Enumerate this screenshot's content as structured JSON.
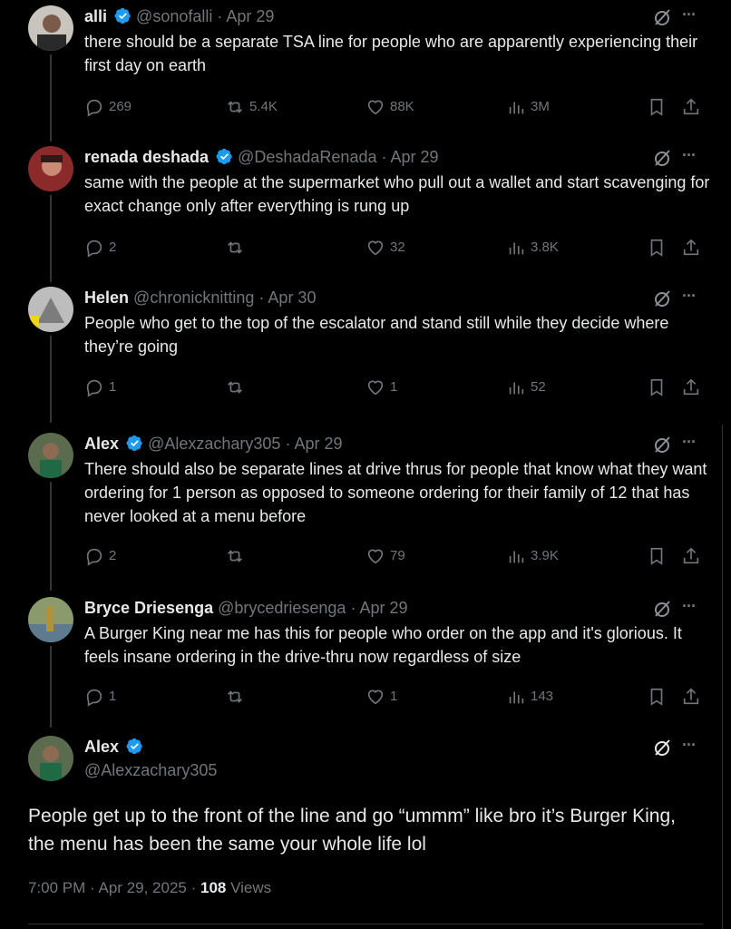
{
  "colors": {
    "background": "#000000",
    "text": "#e7e9ea",
    "muted": "#71767b",
    "verified": "#1d9bf0"
  },
  "replies": [
    {
      "name": "alli",
      "verified": true,
      "handle": "@sonofalli",
      "date": "Apr 29",
      "text": "there should be a separate TSA line for people who are apparently experiencing their first day on earth",
      "replies": "269",
      "reposts": "5.4K",
      "likes": "88K",
      "views": "3M"
    },
    {
      "name": "renada deshada",
      "verified": true,
      "handle": "@DeshadaRenada",
      "date": "Apr 29",
      "text": "same with the people at the supermarket who  pull out a wallet and start scavenging for exact change only after everything is rung up",
      "replies": "2",
      "reposts": "",
      "likes": "32",
      "views": "3.8K"
    },
    {
      "name": "Helen",
      "verified": false,
      "handle": "@chronicknitting",
      "date": "Apr 30",
      "text": "People who get to the top of the escalator and stand still while they decide where they’re going",
      "replies": "1",
      "reposts": "",
      "likes": "1",
      "views": "52"
    },
    {
      "name": "Alex",
      "verified": true,
      "handle": "@Alexzachary305",
      "date": "Apr 29",
      "text": "There should also be separate lines at drive thrus for people that know what they want ordering for 1 person as opposed to someone ordering for their family of 12 that has never looked at a menu before",
      "replies": "2",
      "reposts": "",
      "likes": "79",
      "views": "3.9K"
    },
    {
      "name": "Bryce Driesenga",
      "verified": false,
      "handle": "@brycedriesenga",
      "date": "Apr 29",
      "text": "A Burger King near me has this for people who order on the app and it's glorious. It feels insane ordering in the drive-thru now regardless of size",
      "replies": "1",
      "reposts": "",
      "likes": "1",
      "views": "143"
    }
  ],
  "main": {
    "name": "Alex",
    "verified": true,
    "handle": "@Alexzachary305",
    "text": "People get up to the front of the line and go “ummm” like bro it’s Burger King, the menu has been the same your whole life lol",
    "time": "7:00 PM",
    "date": "Apr 29, 2025",
    "views_count": "108",
    "views_label": "Views"
  },
  "icons": {
    "reply": "reply-icon",
    "repost": "repost-icon",
    "like": "heart-icon",
    "views": "analytics-icon",
    "bookmark": "bookmark-icon",
    "share": "share-icon",
    "grok": "grok-icon",
    "more": "more-icon",
    "verified": "verified-badge-icon"
  }
}
